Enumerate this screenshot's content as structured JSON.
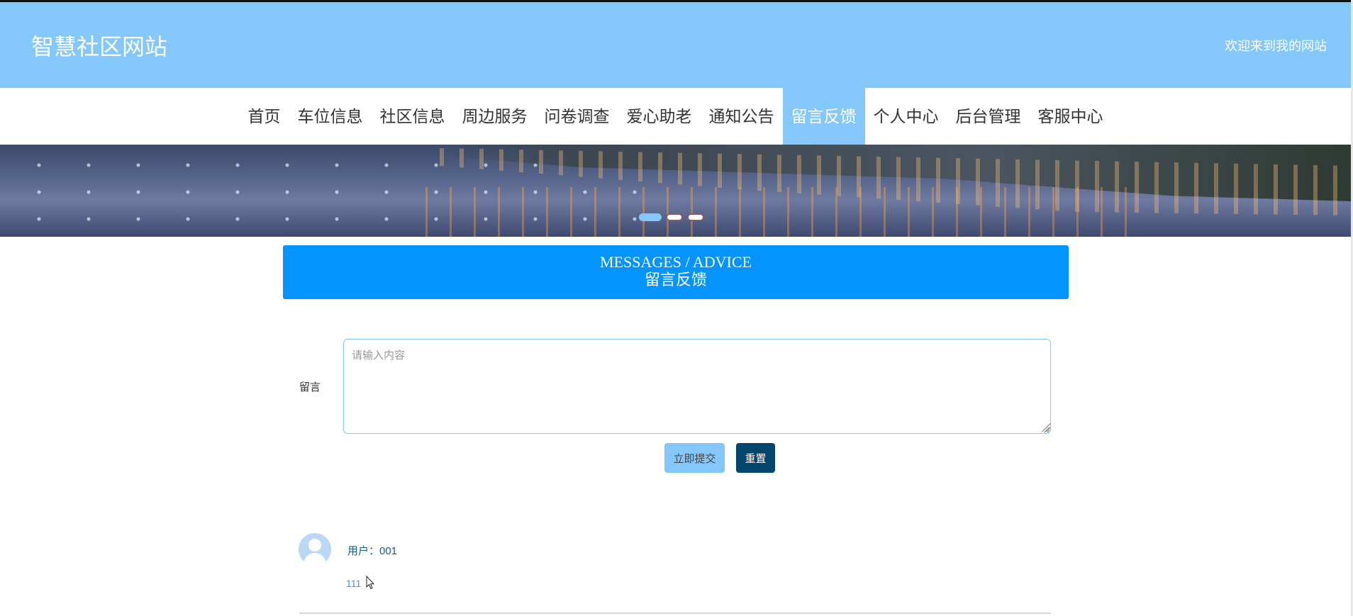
{
  "header": {
    "site_title": "智慧社区网站",
    "welcome_text": "欢迎来到我的网站"
  },
  "nav": {
    "items": [
      {
        "label": "首页"
      },
      {
        "label": "车位信息"
      },
      {
        "label": "社区信息"
      },
      {
        "label": "周边服务"
      },
      {
        "label": "问卷调查"
      },
      {
        "label": "爱心助老"
      },
      {
        "label": "通知公告"
      },
      {
        "label": "留言反馈",
        "active": true
      },
      {
        "label": "个人中心"
      },
      {
        "label": "后台管理"
      },
      {
        "label": "客服中心"
      }
    ]
  },
  "carousel": {
    "slide_count": 3,
    "active_index": 0
  },
  "section": {
    "title_en": "MESSAGES / ADVICE",
    "title_zh": "留言反馈"
  },
  "form": {
    "label": "留言",
    "placeholder": "请输入内容",
    "value": "",
    "submit_label": "立即提交",
    "reset_label": "重置"
  },
  "messages": [
    {
      "user_label": "用户：001",
      "content": "111"
    }
  ],
  "colors": {
    "header_bg": "#84c8fb",
    "section_bg": "#0593fd",
    "reset_bg": "#02456d"
  }
}
